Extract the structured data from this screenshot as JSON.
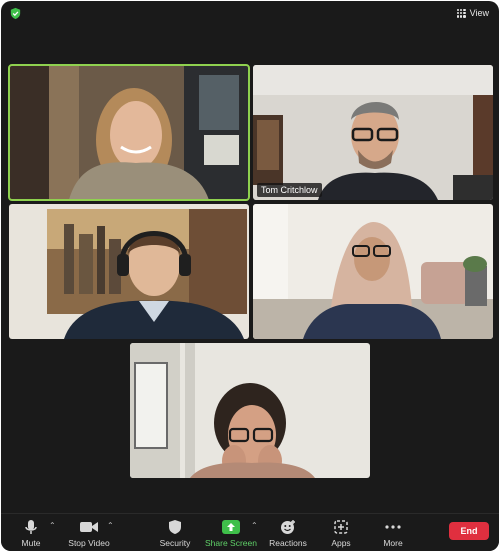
{
  "header": {
    "view_label": "View"
  },
  "participants": [
    {
      "name": "",
      "active": true
    },
    {
      "name": "Tom Critchlow",
      "active": false
    },
    {
      "name": "",
      "active": false
    },
    {
      "name": "",
      "active": false
    },
    {
      "name": "",
      "active": false
    }
  ],
  "toolbar": {
    "mute": "Mute",
    "stop_video": "Stop Video",
    "security": "Security",
    "share_screen": "Share Screen",
    "reactions": "Reactions",
    "apps": "Apps",
    "more": "More",
    "end": "End"
  },
  "colors": {
    "active_border": "#8fd14f",
    "share_green": "#3fbf4a",
    "end_red": "#e02f3f"
  }
}
